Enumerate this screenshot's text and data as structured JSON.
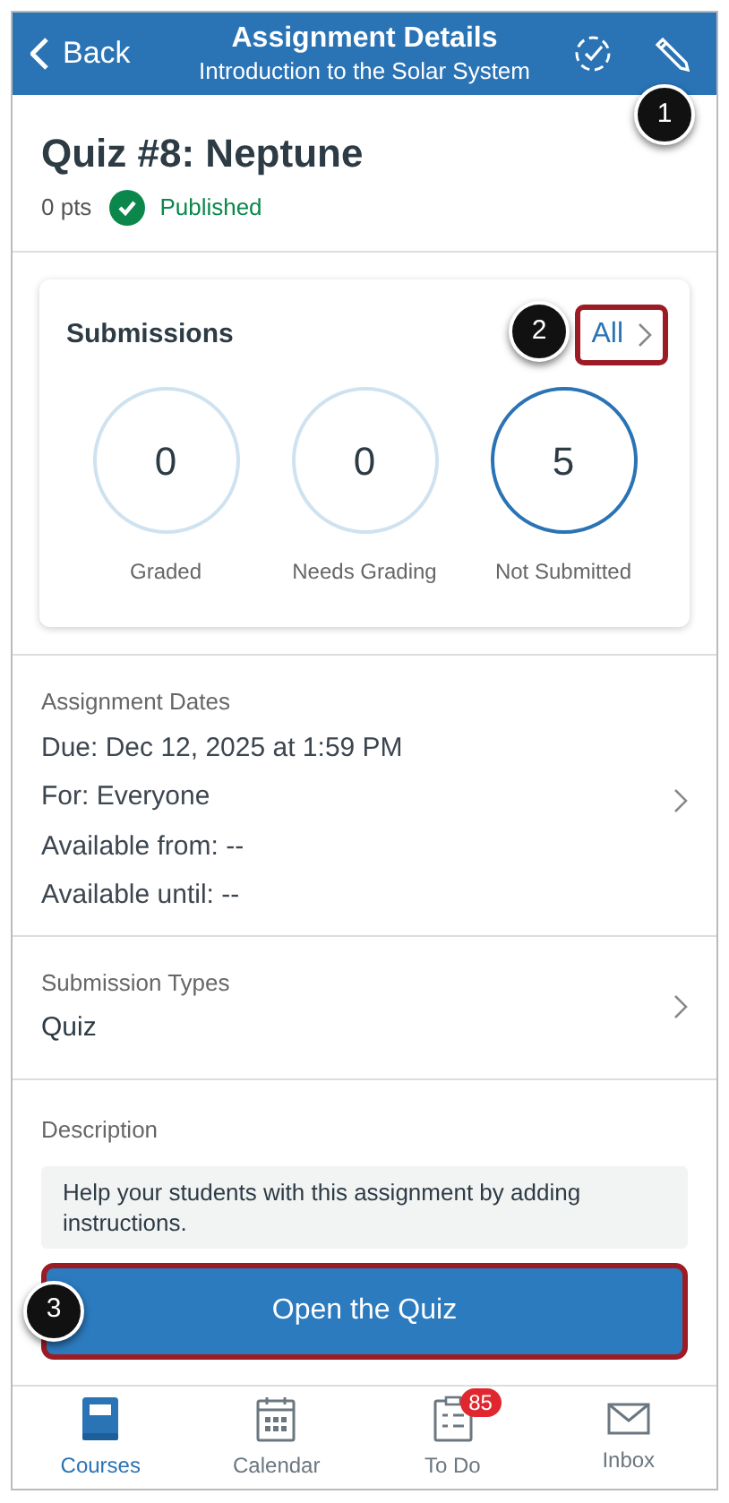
{
  "header": {
    "back": "Back",
    "title": "Assignment Details",
    "subtitle": "Introduction to the Solar System"
  },
  "assignment": {
    "title": "Quiz #8: Neptune",
    "points": "0 pts",
    "status": "Published",
    "published": true
  },
  "submissions": {
    "title": "Submissions",
    "link": "All",
    "stats": [
      {
        "value": "0",
        "label": "Graded",
        "emphasized": false
      },
      {
        "value": "0",
        "label": "Needs Grading",
        "emphasized": false
      },
      {
        "value": "5",
        "label": "Not Submitted",
        "emphasized": true
      }
    ]
  },
  "dates": {
    "heading": "Assignment Dates",
    "rows": [
      {
        "text": "Due: Dec 12, 2025 at 1:59 PM"
      },
      {
        "text": "For: Everyone"
      },
      {
        "text": "Available from: --"
      },
      {
        "text": "Available until: --"
      }
    ]
  },
  "submission_types": {
    "heading": "Submission Types",
    "value": "Quiz"
  },
  "description": {
    "heading": "Description",
    "text": "Help your students with this assignment by adding instructions."
  },
  "open_button": "Open the Quiz",
  "callouts": [
    "1",
    "2",
    "3"
  ],
  "tab_bar": [
    {
      "label": "Courses",
      "selected": true,
      "kind": "courses"
    },
    {
      "label": "Calendar",
      "selected": false,
      "kind": "calendar"
    },
    {
      "label": "To Do",
      "selected": false,
      "kind": "todo",
      "badge": "85"
    },
    {
      "label": "Inbox",
      "selected": false,
      "kind": "inbox"
    }
  ]
}
